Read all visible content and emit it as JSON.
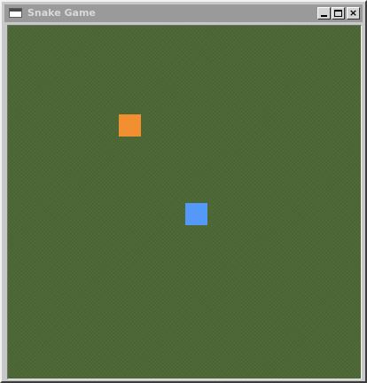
{
  "window": {
    "title": "Snake Game",
    "title_icon": "window-icon",
    "controls": [
      {
        "name": "minimize",
        "icon": "minimize-icon"
      },
      {
        "name": "maximize",
        "icon": "maximize-icon"
      },
      {
        "name": "close",
        "icon": "close-icon",
        "glyph": "×"
      }
    ]
  },
  "game": {
    "board_color": "#4c6734",
    "food": {
      "color": "#f28f30",
      "grid_col": 5,
      "grid_row": 4
    },
    "snake": {
      "color": "#5599f8",
      "length": 1,
      "head_grid_col": 8,
      "head_grid_row": 8
    }
  }
}
